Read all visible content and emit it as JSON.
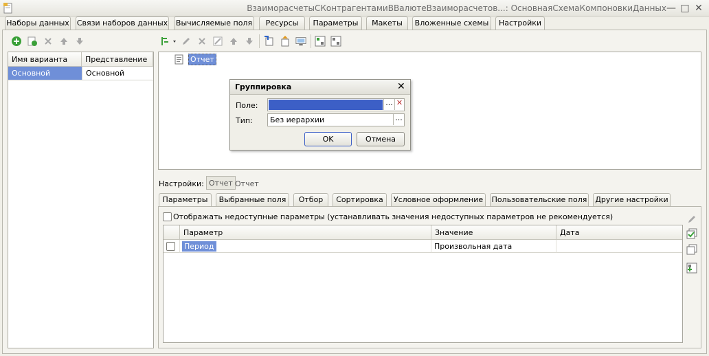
{
  "window": {
    "title": "ВзаиморасчетыСКонтрагентамиВВалютеВзаиморасчетов...: ОсновнаяСхемаКомпоновкиДанных"
  },
  "main_tabs": [
    {
      "label": "Наборы данных"
    },
    {
      "label": "Связи наборов данных"
    },
    {
      "label": "Вычисляемые поля"
    },
    {
      "label": "Ресурсы"
    },
    {
      "label": "Параметры"
    },
    {
      "label": "Макеты"
    },
    {
      "label": "Вложенные схемы"
    },
    {
      "label": "Настройки"
    }
  ],
  "active_main_tab": "Настройки",
  "variants": {
    "columns": [
      "Имя варианта",
      "Представление"
    ],
    "rows": [
      {
        "name": "Основной",
        "presentation": "Основной"
      }
    ]
  },
  "structure": {
    "root_item": "Отчет"
  },
  "grouping_dialog": {
    "title": "Группировка",
    "field_label": "Поле:",
    "field_value": "",
    "type_label": "Тип:",
    "type_value": "Без иерархии",
    "ok_label": "OK",
    "cancel_label": "Отмена"
  },
  "settings_bar": {
    "label": "Настройки:",
    "active_item": "Отчет",
    "second_item": "Отчет"
  },
  "lower_tabs": [
    {
      "label": "Параметры"
    },
    {
      "label": "Выбранные поля"
    },
    {
      "label": "Отбор"
    },
    {
      "label": "Сортировка"
    },
    {
      "label": "Условное оформление"
    },
    {
      "label": "Пользовательские поля"
    },
    {
      "label": "Другие настройки"
    }
  ],
  "active_lower_tab": "Параметры",
  "params": {
    "show_unavailable_label": "Отображать недоступные параметры (устанавливать значения недоступных параметров не рекомендуется)",
    "show_unavailable_checked": false,
    "columns": [
      "Параметр",
      "Значение",
      "Дата"
    ],
    "rows": [
      {
        "checked": false,
        "parameter": "Период",
        "value": "Произвольная дата",
        "date": ""
      }
    ]
  },
  "colors": {
    "selection": "#6f8fd8",
    "field_highlight": "#3c5fc6",
    "icon_green": "#3aa038",
    "icon_gray": "#a8a8a8"
  }
}
